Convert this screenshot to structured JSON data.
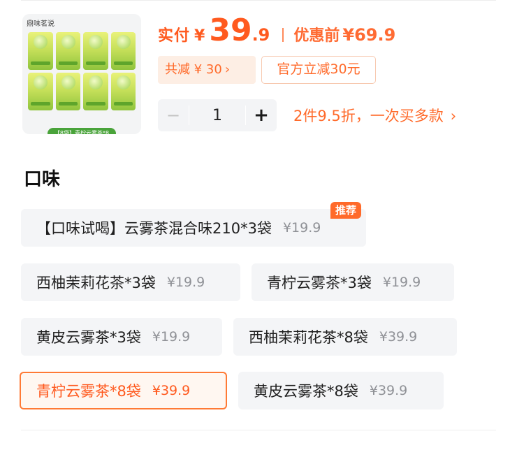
{
  "product": {
    "brand_text": "鼎味茗说",
    "caption": "【8袋】青柠云雾茶*8"
  },
  "price": {
    "paid_label": "实付",
    "currency": "¥",
    "integer": "39",
    "decimal": ".9",
    "before_label": "优惠前",
    "before_price": "¥69.9"
  },
  "discount": {
    "total_label": "共减 ¥ 30",
    "arrow": "›",
    "official": "官方立减30元"
  },
  "quantity": {
    "minus": "−",
    "value": "1",
    "plus": "+"
  },
  "bulk_offer": {
    "text": "2件9.5折，一次买多款",
    "arrow": "›"
  },
  "flavor": {
    "title": "口味",
    "badge": "推荐",
    "selected_index": 6,
    "options": [
      {
        "name": "【口味试喝】云雾茶混合味210*3袋",
        "price": "¥19.9"
      },
      {
        "name": "西柚茉莉花茶*3袋",
        "price": "¥19.9"
      },
      {
        "name": "青柠云雾茶*3袋",
        "price": "¥19.9"
      },
      {
        "name": "黄皮云雾茶*3袋",
        "price": "¥19.9"
      },
      {
        "name": "西柚茉莉花茶*8袋",
        "price": "¥39.9"
      },
      {
        "name": "青柠云雾茶*8袋",
        "price": "¥39.9"
      },
      {
        "name": "黄皮云雾茶*8袋",
        "price": "¥39.9"
      }
    ]
  },
  "colors": {
    "accent": "#ff5a1f",
    "chip_bg": "#fdeee4",
    "option_bg": "#f4f5f7",
    "selected_bg": "#fff7f1"
  }
}
